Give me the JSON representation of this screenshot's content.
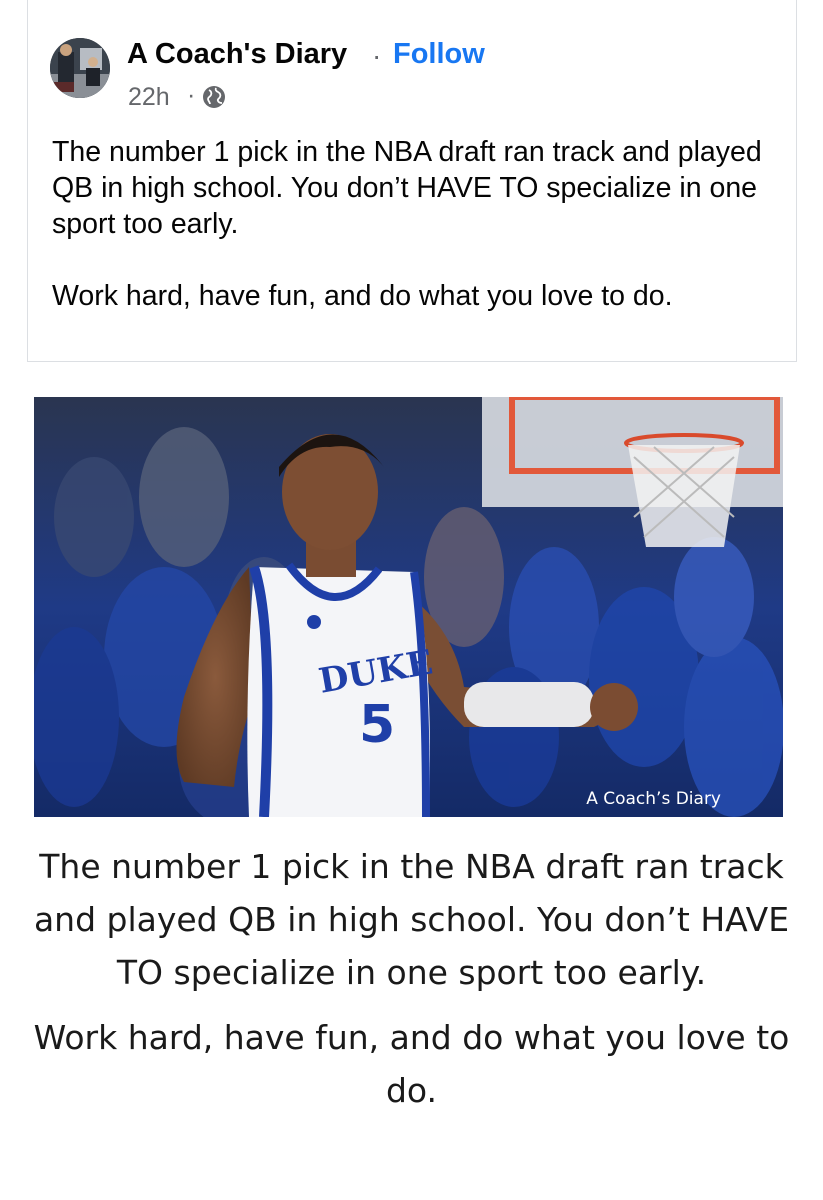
{
  "post": {
    "page_name": "A Coach's Diary",
    "separator": "·",
    "follow_label": "Follow",
    "timestamp": "22h",
    "timestamp_separator": "·",
    "audience_icon": "globe-icon",
    "text_paragraph_1": "The number 1 pick in the NBA draft ran track and played QB in high school. You don’t HAVE TO specialize in one sport too early.",
    "text_paragraph_2": "Work hard, have fun, and do what you love to do."
  },
  "image": {
    "jersey_name": "DUKE",
    "jersey_number": "5",
    "watermark": "A Coach’s Diary",
    "caption_paragraph_1": "The number 1 pick in the NBA draft ran track and played QB in high school. You don’t HAVE TO specialize in one sport too early.",
    "caption_paragraph_2": "Work hard, have fun, and do what you love to do."
  },
  "colors": {
    "follow": "#1877f2",
    "jersey_blue": "#1f3fa8",
    "crowd_blue": "#1c3a8c"
  }
}
